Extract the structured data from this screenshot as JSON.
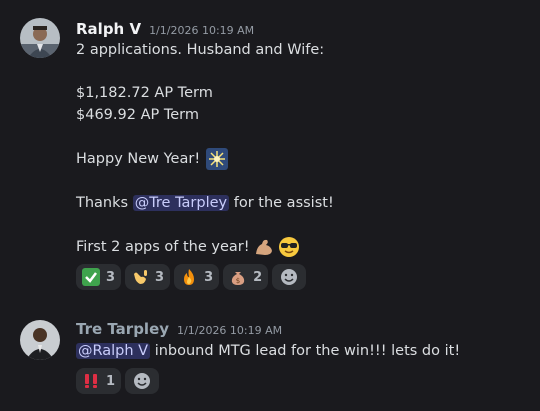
{
  "messages": [
    {
      "username": "Ralph V",
      "username_color": "#f2f3f5",
      "timestamp": "1/1/2026 10:19 AM",
      "lines": {
        "l1": "2 applications. Husband and Wife:",
        "l2": "$1,182.72 AP Term",
        "l3": "$469.92 AP Term",
        "l4": "Happy New Year!",
        "l5_pre": "Thanks ",
        "l5_mention": "@Tre Tarpley",
        "l5_post": " for the assist!",
        "l6": "First 2 apps of the year!"
      },
      "reactions": [
        {
          "icon": "check-mark-icon",
          "count": "3"
        },
        {
          "icon": "call-me-hand-icon",
          "count": "3"
        },
        {
          "icon": "fire-icon",
          "count": "3"
        },
        {
          "icon": "money-bag-icon",
          "count": "2"
        }
      ]
    },
    {
      "username": "Tre Tarpley",
      "username_color": "#9aa7b2",
      "timestamp": "1/1/2026 10:19 AM",
      "lines": {
        "mention": "@Ralph V",
        "text": " inbound MTG lead for the win!!! lets do it!"
      },
      "reactions": [
        {
          "icon": "double-exclamation-icon",
          "count": "1"
        }
      ]
    }
  ],
  "colors": {
    "background": "#1a1a1e",
    "mention_bg": "#3a3e7a",
    "mention_text": "#c9cdfb",
    "reaction_bg": "#2b2d31"
  }
}
